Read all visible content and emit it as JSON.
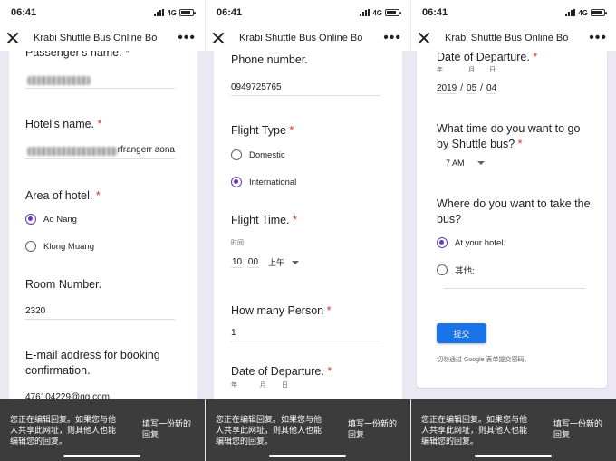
{
  "status_bar": {
    "time": "06:41",
    "network": "4G"
  },
  "nav": {
    "title": "Krabi Shuttle Bus Online Bo",
    "more": "•••"
  },
  "required_mark": "*",
  "panel1": {
    "passenger_label": "Passenger's name.",
    "hotel_label": "Hotel's name.",
    "hotel_value": "rfrangerr aona",
    "area_label": "Area of hotel.",
    "area_options": [
      "Ao Nang",
      "Klong Muang"
    ],
    "area_selected": "Ao Nang",
    "room_label": "Room Number.",
    "room_value": "2320",
    "email_label": "E-mail address for booking confirmation.",
    "email_value": "476104229@qq.com"
  },
  "panel2": {
    "phone_label": "Phone number.",
    "phone_value": "0949725765",
    "flight_type_label": "Flight Type",
    "flight_type_options": [
      "Domestic",
      "International"
    ],
    "flight_type_selected": "International",
    "flight_time_label": "Flight Time.",
    "time_caption": "时间",
    "time_hour": "10",
    "time_colon": ":",
    "time_minute": "00",
    "time_ampm": "上午",
    "persons_label": "How many Person",
    "persons_value": "1",
    "departure_label": "Date of Departure.",
    "date_caption_year": "年",
    "date_caption_month": "月",
    "date_caption_day": "日"
  },
  "panel3": {
    "departure_label": "Date of Departure.",
    "date_caption_year": "年",
    "date_caption_month": "月",
    "date_caption_day": "日",
    "date_year": "2019",
    "date_sep": "/",
    "date_month": "05",
    "date_day": "04",
    "time_q_label": "What time do you want to go by Shuttle bus?",
    "time_value": "7 AM",
    "where_label": "Where do you want to take the bus?",
    "where_options": [
      "At your hotel.",
      "其他:"
    ],
    "where_selected": "At your hotel.",
    "submit_label": "提交",
    "footer_note": "切勿通过 Google 表单提交密码。"
  },
  "bottom_sheet": {
    "message": "您正在编辑回复。如果您与他人共享此网址，则其他人也能编辑您的回复。",
    "new_response": "填写一份新的回复"
  },
  "colors": {
    "accent": "#673ab7",
    "submit": "#1a73e8",
    "background": "#ece8f3",
    "sheet": "#3c3c3c",
    "required": "#d93025"
  }
}
